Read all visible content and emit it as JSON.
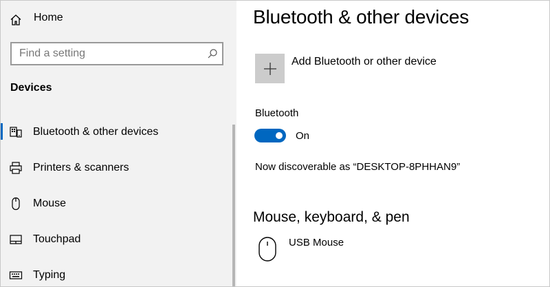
{
  "sidebar": {
    "home": {
      "label": "Home",
      "icon": "home-icon"
    },
    "search": {
      "placeholder": "Find a setting",
      "value": "",
      "icon": "search-icon"
    },
    "section_title": "Devices",
    "items": [
      {
        "label": "Bluetooth & other devices",
        "icon": "bluetooth-devices-icon",
        "selected": true
      },
      {
        "label": "Printers & scanners",
        "icon": "printer-icon",
        "selected": false
      },
      {
        "label": "Mouse",
        "icon": "mouse-icon",
        "selected": false
      },
      {
        "label": "Touchpad",
        "icon": "touchpad-icon",
        "selected": false
      },
      {
        "label": "Typing",
        "icon": "keyboard-icon",
        "selected": false
      }
    ]
  },
  "main": {
    "title": "Bluetooth & other devices",
    "add_device": {
      "label": "Add Bluetooth or other device",
      "icon": "plus-icon"
    },
    "bluetooth": {
      "label": "Bluetooth",
      "state_label": "On",
      "enabled": true
    },
    "discoverable_text": "Now discoverable as “DESKTOP-8PHHAN9”",
    "mouse_section": {
      "heading": "Mouse, keyboard, & pen",
      "devices": [
        {
          "label": "USB Mouse",
          "icon": "mouse-icon"
        }
      ]
    }
  },
  "colors": {
    "accent": "#0067c0",
    "sidebar_bg": "#f2f2f2",
    "tile_bg": "#cccccc"
  }
}
